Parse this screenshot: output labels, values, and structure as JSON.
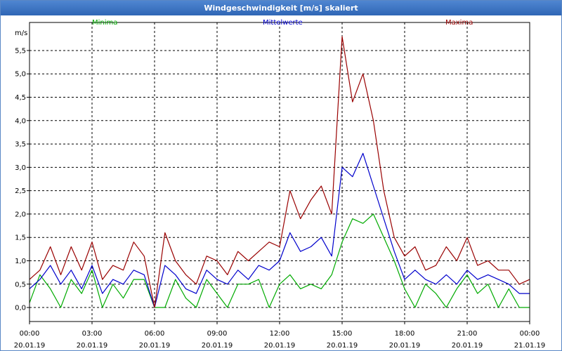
{
  "window": {
    "title": "Windgeschwindigkeit [m/s] skaliert"
  },
  "colors": {
    "min": "#00aa00",
    "mean": "#0000cc",
    "max": "#990000",
    "title_bar": "#3a72c0"
  },
  "chart_data": {
    "type": "line",
    "title": "Windgeschwindigkeit [m/s] skaliert",
    "ylabel": "m/s",
    "ylim": [
      -0.3,
      6.1
    ],
    "yticks": [
      0.0,
      0.5,
      1.0,
      1.5,
      2.0,
      2.5,
      3.0,
      3.5,
      4.0,
      4.5,
      5.0,
      5.5
    ],
    "ytick_labels": [
      "0,0",
      "0,5",
      "1,0",
      "1,5",
      "2,0",
      "2,5",
      "3,0",
      "3,5",
      "4,0",
      "4,5",
      "5,0",
      "5,5"
    ],
    "xlim": [
      0,
      24
    ],
    "xticks": [
      0,
      3,
      6,
      9,
      12,
      15,
      18,
      21,
      24
    ],
    "xtick_time": [
      "00:00",
      "03:00",
      "06:00",
      "09:00",
      "12:00",
      "15:00",
      "18:00",
      "21:00",
      "00:00"
    ],
    "xtick_date": [
      "20.01.19",
      "20.01.19",
      "20.01.19",
      "20.01.19",
      "20.01.19",
      "20.01.19",
      "20.01.19",
      "20.01.19",
      "21.01.19"
    ],
    "grid": true,
    "legend": [
      "Minima",
      "Mittelwerte",
      "Maxima"
    ],
    "series": [
      {
        "name": "Minima",
        "x": [
          0,
          0.5,
          1,
          1.5,
          2,
          2.5,
          3,
          3.5,
          4,
          4.5,
          5,
          5.5,
          6,
          6.5,
          7,
          7.5,
          8,
          8.5,
          9,
          9.5,
          10,
          10.5,
          11,
          11.5,
          12,
          12.5,
          13,
          13.5,
          14,
          14.5,
          15,
          15.5,
          16,
          16.5,
          17,
          17.5,
          18,
          18.5,
          19,
          19.5,
          20,
          20.5,
          21,
          21.5,
          22,
          22.5,
          23,
          23.5,
          24
        ],
        "values": [
          0.1,
          0.7,
          0.4,
          0.0,
          0.6,
          0.3,
          0.8,
          0.0,
          0.5,
          0.2,
          0.6,
          0.6,
          0.0,
          0.0,
          0.6,
          0.2,
          0.0,
          0.6,
          0.3,
          0.0,
          0.5,
          0.5,
          0.6,
          0.0,
          0.5,
          0.7,
          0.4,
          0.5,
          0.4,
          0.7,
          1.4,
          1.9,
          1.8,
          2.0,
          1.5,
          1.0,
          0.4,
          0.0,
          0.5,
          0.3,
          0.0,
          0.4,
          0.7,
          0.3,
          0.5,
          0.0,
          0.4,
          0.0,
          0.0
        ]
      },
      {
        "name": "Mittelwerte",
        "x": [
          0,
          0.5,
          1,
          1.5,
          2,
          2.5,
          3,
          3.5,
          4,
          4.5,
          5,
          5.5,
          6,
          6.5,
          7,
          7.5,
          8,
          8.5,
          9,
          9.5,
          10,
          10.5,
          11,
          11.5,
          12,
          12.5,
          13,
          13.5,
          14,
          14.5,
          15,
          15.5,
          16,
          16.5,
          17,
          17.5,
          18,
          18.5,
          19,
          19.5,
          20,
          20.5,
          21,
          21.5,
          22,
          22.5,
          23,
          23.5,
          24
        ],
        "values": [
          0.4,
          0.6,
          0.9,
          0.5,
          0.8,
          0.4,
          0.9,
          0.3,
          0.6,
          0.5,
          0.8,
          0.7,
          0.0,
          0.9,
          0.7,
          0.4,
          0.3,
          0.8,
          0.6,
          0.5,
          0.8,
          0.6,
          0.9,
          0.8,
          1.0,
          1.6,
          1.2,
          1.3,
          1.5,
          1.1,
          3.0,
          2.8,
          3.3,
          2.6,
          1.9,
          1.2,
          0.6,
          0.8,
          0.6,
          0.5,
          0.7,
          0.5,
          0.8,
          0.6,
          0.7,
          0.6,
          0.5,
          0.3,
          0.3
        ]
      },
      {
        "name": "Maxima",
        "x": [
          0,
          0.5,
          1,
          1.5,
          2,
          2.5,
          3,
          3.5,
          4,
          4.5,
          5,
          5.5,
          6,
          6.5,
          7,
          7.5,
          8,
          8.5,
          9,
          9.5,
          10,
          10.5,
          11,
          11.5,
          12,
          12.5,
          13,
          13.5,
          14,
          14.5,
          15,
          15.5,
          16,
          16.5,
          17,
          17.5,
          18,
          18.5,
          19,
          19.5,
          20,
          20.5,
          21,
          21.5,
          22,
          22.5,
          23,
          23.5,
          24
        ],
        "values": [
          0.6,
          0.8,
          1.3,
          0.7,
          1.3,
          0.8,
          1.4,
          0.6,
          0.9,
          0.8,
          1.4,
          1.1,
          0.0,
          1.6,
          1.0,
          0.7,
          0.5,
          1.1,
          1.0,
          0.7,
          1.2,
          1.0,
          1.2,
          1.4,
          1.3,
          2.5,
          1.9,
          2.3,
          2.6,
          2.0,
          5.8,
          4.4,
          5.0,
          4.0,
          2.5,
          1.5,
          1.1,
          1.3,
          0.8,
          0.9,
          1.3,
          1.0,
          1.5,
          0.9,
          1.0,
          0.8,
          0.8,
          0.5,
          0.6
        ]
      }
    ]
  }
}
